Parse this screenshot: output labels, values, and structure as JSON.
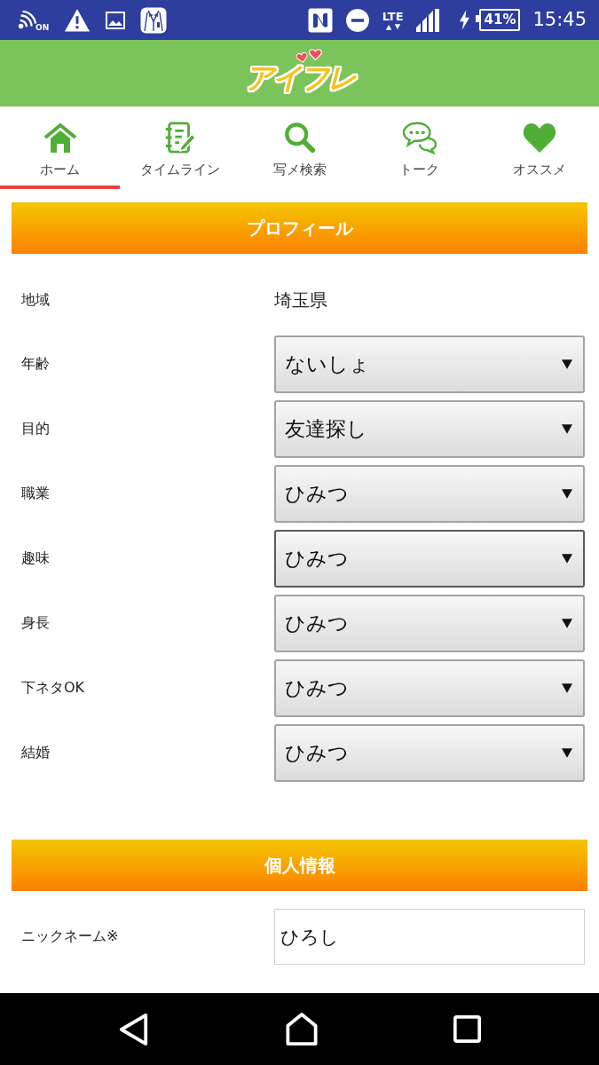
{
  "status_bar": {
    "nfc_label": "ON",
    "network": "LTE",
    "battery": "41%",
    "time": "15:45"
  },
  "header": {
    "logo": "アイフレ"
  },
  "tabs": [
    {
      "label": "ホーム",
      "kind": "home",
      "selected": true
    },
    {
      "label": "タイムライン",
      "kind": "timeline",
      "selected": false
    },
    {
      "label": "写メ検索",
      "kind": "search",
      "selected": false
    },
    {
      "label": "トーク",
      "kind": "talk",
      "selected": false
    },
    {
      "label": "オススメ",
      "kind": "recommend",
      "selected": false
    }
  ],
  "sections": [
    {
      "title": "プロフィール",
      "rows": [
        {
          "label": "地域",
          "kind": "text",
          "value": "埼玉県"
        },
        {
          "label": "年齢",
          "kind": "select",
          "value": "ないしょ",
          "focused": false
        },
        {
          "label": "目的",
          "kind": "select",
          "value": "友達探し",
          "focused": false
        },
        {
          "label": "職業",
          "kind": "select",
          "value": "ひみつ",
          "focused": false
        },
        {
          "label": "趣味",
          "kind": "select",
          "value": "ひみつ",
          "focused": true
        },
        {
          "label": "身長",
          "kind": "select",
          "value": "ひみつ",
          "focused": false
        },
        {
          "label": "下ネタOK",
          "kind": "select",
          "value": "ひみつ",
          "focused": false
        },
        {
          "label": "結婚",
          "kind": "select",
          "value": "ひみつ",
          "focused": false
        }
      ]
    },
    {
      "title": "個人情報",
      "rows": [
        {
          "label": "ニックネーム※",
          "kind": "input",
          "value": "ひろし",
          "focused": false
        }
      ]
    }
  ]
}
